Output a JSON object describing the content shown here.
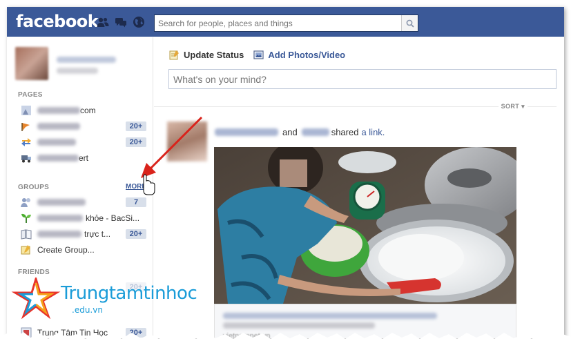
{
  "header": {
    "logo": "facebook",
    "search_placeholder": "Search for people, places and things"
  },
  "sidebar": {
    "pages_title": "PAGES",
    "pages": [
      {
        "label_visible": "com",
        "count": ""
      },
      {
        "label_visible": "",
        "count": "20+"
      },
      {
        "label_visible": "",
        "count": "20+"
      },
      {
        "label_visible": "ert",
        "count": ""
      }
    ],
    "groups_title": "GROUPS",
    "more_label": "MORE",
    "groups": [
      {
        "label_visible": "",
        "count": "7"
      },
      {
        "label_visible": "khỏe - BacSi...",
        "count": ""
      },
      {
        "label_visible": "trực t...",
        "count": "20+"
      }
    ],
    "create_group": "Create Group...",
    "friends_title": "FRIENDS",
    "friends": [
      {
        "label_visible": "",
        "count": "20+"
      },
      {
        "label_visible": "Trung Tâm Tin Học",
        "count": "20+"
      }
    ]
  },
  "composer": {
    "update_status": "Update Status",
    "add_photos": "Add Photos/Video",
    "placeholder": "What's on your mind?"
  },
  "feed": {
    "sort_label": "SORT",
    "story": {
      "connector": "and",
      "shared_text": "shared",
      "link_text": "a link."
    },
    "link_card_source": "vietnamnet.vn"
  },
  "watermark": {
    "brand": "Trungtamtinhoc",
    "domain": ".edu.vn"
  },
  "colors": {
    "brand_blue": "#3b5998",
    "count_bg": "#d8dfea",
    "watermark_blue": "#1a9cd8",
    "annotation_arrow": "#d9231b"
  },
  "icons": [
    "friend-requests-icon",
    "messages-icon",
    "notifications-globe-icon",
    "search-icon",
    "status-pencil-icon",
    "photo-icon",
    "sort-caret-icon",
    "hand-cursor-icon",
    "annotation-arrow"
  ]
}
